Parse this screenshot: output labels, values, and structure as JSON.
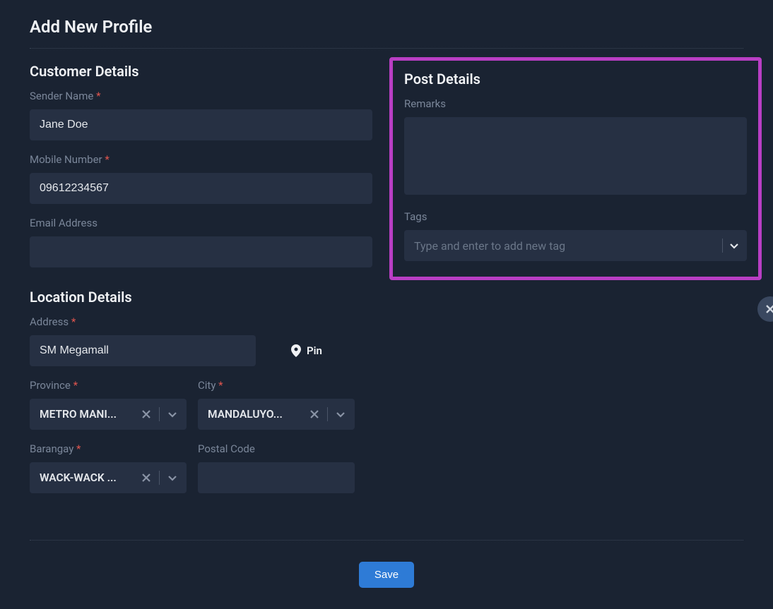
{
  "page_title": "Add New Profile",
  "customer": {
    "section_title": "Customer Details",
    "sender_name_label": "Sender Name",
    "sender_name_value": "Jane Doe",
    "mobile_label": "Mobile Number",
    "mobile_value": "09612234567",
    "email_label": "Email Address",
    "email_value": ""
  },
  "post": {
    "section_title": "Post Details",
    "remarks_label": "Remarks",
    "remarks_value": "",
    "tags_label": "Tags",
    "tags_placeholder": "Type and enter to add new tag"
  },
  "location": {
    "section_title": "Location Details",
    "address_label": "Address",
    "address_value": "SM Megamall",
    "pin_label": "Pin",
    "province_label": "Province",
    "province_value": "METRO MANI...",
    "city_label": "City",
    "city_value": "MANDALUYO...",
    "barangay_label": "Barangay",
    "barangay_value": "WACK-WACK ...",
    "postal_label": "Postal Code",
    "postal_value": ""
  },
  "actions": {
    "save_label": "Save"
  },
  "required_marker": "*"
}
